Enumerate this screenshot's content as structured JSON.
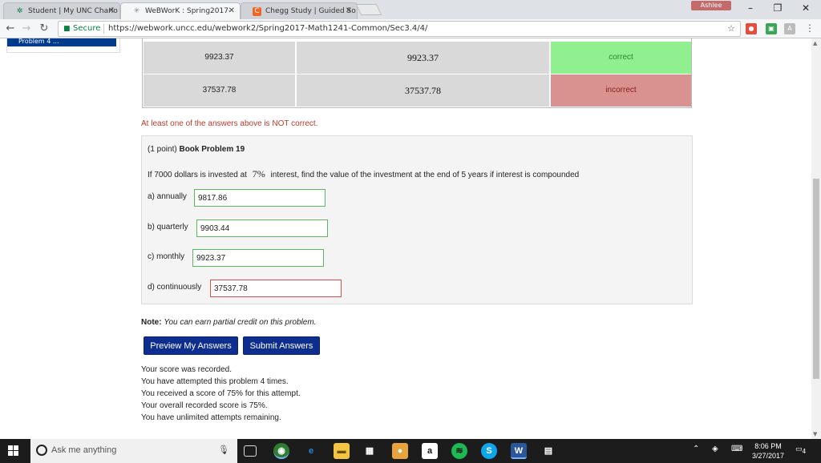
{
  "tabs": [
    {
      "title": "Student | My UNC Charlo",
      "favicon": "✲"
    },
    {
      "title": "WeBWorK : Spring2017-",
      "favicon": "✳"
    },
    {
      "title": "Chegg Study | Guided So",
      "favicon": "C"
    }
  ],
  "user_badge": "Ashlee",
  "addressbar": {
    "secure_label": "Secure",
    "url": "https://webwork.uncc.edu/webwork2/Spring2017-Math1241-Common/Sec3.4/4/"
  },
  "sidebar": {
    "current_problem": "Problem 4 ..."
  },
  "results": [
    {
      "entered": "9923.37",
      "preview": "9923.37",
      "result": "correct",
      "color": "#90f090"
    },
    {
      "entered": "37537.78",
      "preview": "37537.78",
      "result": "incorrect",
      "color": "#d9928f"
    }
  ],
  "warning": "At least one of the answers above is NOT correct.",
  "problem": {
    "points": "(1 point)",
    "title": "Book Problem 19",
    "text_before": "If 7000 dollars is invested at",
    "rate": "7%",
    "text_after": "interest, find the value of the investment at the end of 5 years if interest is compounded",
    "questions": [
      {
        "label": "a) annually",
        "value": "9817.86"
      },
      {
        "label": "b) quarterly",
        "value": "9903.44"
      },
      {
        "label": "c) monthly",
        "value": "9923.37"
      },
      {
        "label": "d) continuously",
        "value": "37537.78"
      }
    ]
  },
  "note": {
    "label": "Note:",
    "text": "You can earn partial credit on this problem."
  },
  "buttons": {
    "preview": "Preview My Answers",
    "submit": "Submit Answers"
  },
  "status_lines": [
    "Your score was recorded.",
    "You have attempted this problem 4 times.",
    "You received a score of 75% for this attempt.",
    "Your overall recorded score is 75%.",
    "You have unlimited attempts remaining."
  ],
  "taskbar": {
    "search_placeholder": "Ask me anything",
    "time": "8:06 PM",
    "date": "3/27/2017",
    "notifications": "4"
  },
  "colors": {
    "button": "#0d2d8f",
    "correct": "#90f090",
    "incorrect": "#d9928f",
    "warning": "#c0392b"
  }
}
